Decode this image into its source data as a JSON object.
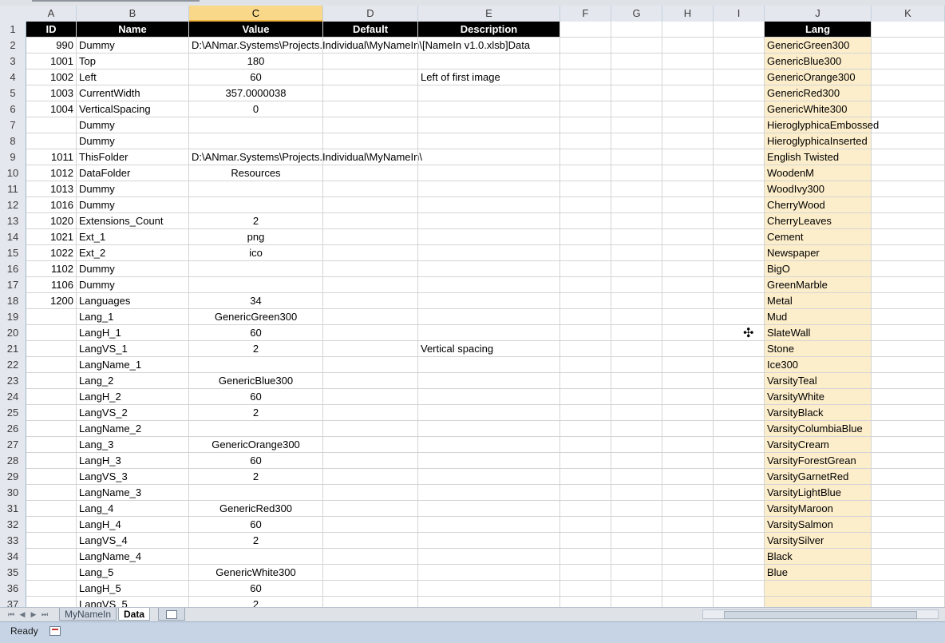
{
  "columns": [
    "A",
    "B",
    "C",
    "D",
    "E",
    "F",
    "G",
    "H",
    "I",
    "J",
    "K"
  ],
  "selected_column": "C",
  "header_row": {
    "num": "1",
    "A": "ID",
    "B": "Name",
    "C": "Value",
    "D": "Default",
    "E": "Description",
    "J": "Lang"
  },
  "rows": [
    {
      "num": "2",
      "A": "990",
      "B": "Dummy",
      "C": "D:\\ANmar.Systems\\Projects.Individual\\MyNameIn\\[NameIn v1.0.xlsb]Data",
      "E": "",
      "J": "GenericGreen300"
    },
    {
      "num": "3",
      "A": "1001",
      "B": "Top",
      "C": "180",
      "E": "",
      "J": "GenericBlue300"
    },
    {
      "num": "4",
      "A": "1002",
      "B": "Left",
      "C": "60",
      "E": "Left of first image",
      "J": "GenericOrange300"
    },
    {
      "num": "5",
      "A": "1003",
      "B": "CurrentWidth",
      "C": "357.0000038",
      "E": "",
      "J": "GenericRed300"
    },
    {
      "num": "6",
      "A": "1004",
      "B": "VerticalSpacing",
      "C": "0",
      "E": "",
      "J": "GenericWhite300"
    },
    {
      "num": "7",
      "A": "",
      "B": "Dummy",
      "C": "",
      "E": "",
      "J": "HieroglyphicaEmbossed"
    },
    {
      "num": "8",
      "A": "",
      "B": "Dummy",
      "C": "",
      "E": "",
      "J": "HieroglyphicaInserted"
    },
    {
      "num": "9",
      "A": "1011",
      "B": "ThisFolder",
      "C": "D:\\ANmar.Systems\\Projects.Individual\\MyNameIn\\",
      "E": "",
      "J": "English Twisted"
    },
    {
      "num": "10",
      "A": "1012",
      "B": "DataFolder",
      "C": "Resources",
      "E": "",
      "J": "WoodenM"
    },
    {
      "num": "11",
      "A": "1013",
      "B": "Dummy",
      "C": "",
      "E": "",
      "J": "WoodIvy300"
    },
    {
      "num": "12",
      "A": "1016",
      "B": "Dummy",
      "C": "",
      "E": "",
      "J": "CherryWood"
    },
    {
      "num": "13",
      "A": "1020",
      "B": "Extensions_Count",
      "C": "2",
      "E": "",
      "J": "CherryLeaves"
    },
    {
      "num": "14",
      "A": "1021",
      "B": "Ext_1",
      "C": "png",
      "E": "",
      "J": "Cement"
    },
    {
      "num": "15",
      "A": "1022",
      "B": "Ext_2",
      "C": "ico",
      "E": "",
      "J": "Newspaper"
    },
    {
      "num": "16",
      "A": "1102",
      "B": "Dummy",
      "C": "",
      "E": "",
      "J": "BigO"
    },
    {
      "num": "17",
      "A": "1106",
      "B": "Dummy",
      "C": "",
      "E": "",
      "J": "GreenMarble"
    },
    {
      "num": "18",
      "A": "1200",
      "B": "Languages",
      "C": "34",
      "E": "",
      "J": "Metal"
    },
    {
      "num": "19",
      "A": "",
      "B": "Lang_1",
      "C": "GenericGreen300",
      "E": "",
      "J": "Mud"
    },
    {
      "num": "20",
      "A": "",
      "B": "LangH_1",
      "C": "60",
      "E": "",
      "J": "SlateWall"
    },
    {
      "num": "21",
      "A": "",
      "B": "LangVS_1",
      "C": "2",
      "E": "Vertical spacing",
      "J": "Stone"
    },
    {
      "num": "22",
      "A": "",
      "B": "LangName_1",
      "C": "",
      "E": "",
      "J": "Ice300"
    },
    {
      "num": "23",
      "A": "",
      "B": "Lang_2",
      "C": "GenericBlue300",
      "E": "",
      "J": "VarsityTeal"
    },
    {
      "num": "24",
      "A": "",
      "B": "LangH_2",
      "C": "60",
      "E": "",
      "J": "VarsityWhite"
    },
    {
      "num": "25",
      "A": "",
      "B": "LangVS_2",
      "C": "2",
      "E": "",
      "J": "VarsityBlack"
    },
    {
      "num": "26",
      "A": "",
      "B": "LangName_2",
      "C": "",
      "E": "",
      "J": "VarsityColumbiaBlue"
    },
    {
      "num": "27",
      "A": "",
      "B": "Lang_3",
      "C": "GenericOrange300",
      "E": "",
      "J": "VarsityCream"
    },
    {
      "num": "28",
      "A": "",
      "B": "LangH_3",
      "C": "60",
      "E": "",
      "J": "VarsityForestGrean"
    },
    {
      "num": "29",
      "A": "",
      "B": "LangVS_3",
      "C": "2",
      "E": "",
      "J": "VarsityGarnetRed"
    },
    {
      "num": "30",
      "A": "",
      "B": "LangName_3",
      "C": "",
      "E": "",
      "J": "VarsityLightBlue"
    },
    {
      "num": "31",
      "A": "",
      "B": "Lang_4",
      "C": "GenericRed300",
      "E": "",
      "J": "VarsityMaroon"
    },
    {
      "num": "32",
      "A": "",
      "B": "LangH_4",
      "C": "60",
      "E": "",
      "J": "VarsitySalmon"
    },
    {
      "num": "33",
      "A": "",
      "B": "LangVS_4",
      "C": "2",
      "E": "",
      "J": "VarsitySilver"
    },
    {
      "num": "34",
      "A": "",
      "B": "LangName_4",
      "C": "",
      "E": "",
      "J": "Black"
    },
    {
      "num": "35",
      "A": "",
      "B": "Lang_5",
      "C": "GenericWhite300",
      "E": "",
      "J": "Blue"
    },
    {
      "num": "36",
      "A": "",
      "B": "LangH_5",
      "C": "60",
      "E": "",
      "J": ""
    },
    {
      "num": "37",
      "A": "",
      "B": "LangVS_5",
      "C": "2",
      "E": "",
      "J": ""
    }
  ],
  "sheet_tabs": [
    {
      "label": "MyNameIn",
      "active": false
    },
    {
      "label": "Data",
      "active": true
    }
  ],
  "status": {
    "ready": "Ready"
  },
  "colors": {
    "lang_fill": "#fdeecb",
    "header_fill": "#000000",
    "selected_column": "#f9d889",
    "statusbar": "#c6d4e6"
  }
}
